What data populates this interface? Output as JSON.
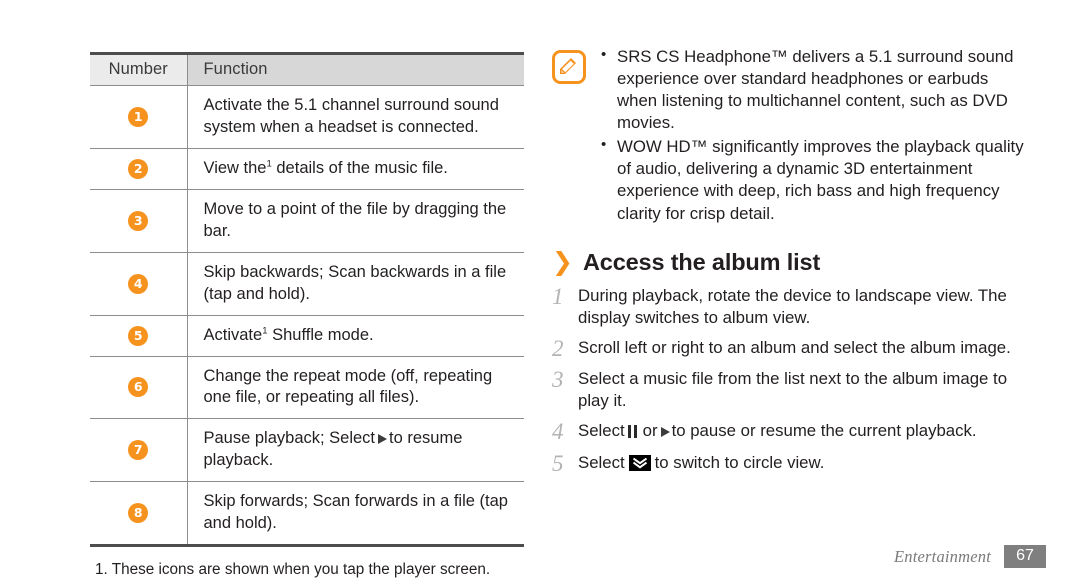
{
  "page": {
    "footer_label": "Entertainment",
    "footer_page_number": "67",
    "accent_color": "#f6921e",
    "text_color": "#231f20",
    "footer_color": "#7f7f7f"
  },
  "table": {
    "headers": {
      "number": "Number",
      "function": "Function"
    },
    "rows": [
      {
        "number": "1",
        "text": "Activate the 5.1 channel surround sound system when a headset is connected.",
        "footnote_marker": ""
      },
      {
        "number": "2",
        "text_before": "View the",
        "footnote_marker": "1",
        "text_after": " details of the music file."
      },
      {
        "number": "3",
        "text": "Move to a point of the file by dragging the bar.",
        "footnote_marker": ""
      },
      {
        "number": "4",
        "text": "Skip backwards; Scan backwards in a file (tap and hold).",
        "footnote_marker": ""
      },
      {
        "number": "5",
        "text_before": "Activate",
        "footnote_marker": "1",
        "text_after": " Shuffle mode."
      },
      {
        "number": "6",
        "text": "Change the repeat mode (off, repeating one file, or repeating all files).",
        "footnote_marker": ""
      },
      {
        "number": "7",
        "text_before": "Pause playback; Select",
        "icon": "play-icon",
        "text_after": "to resume playback."
      },
      {
        "number": "8",
        "text": "Skip forwards; Scan forwards in a file (tap and hold).",
        "footnote_marker": ""
      }
    ],
    "footnote": "1. These icons are shown when you tap the player screen."
  },
  "note": {
    "icon_name": "note-pencil-icon",
    "bullets": [
      "SRS CS Headphone™ delivers a 5.1 surround sound experience over standard headphones or earbuds when listening to multichannel content, such as DVD movies.",
      "WOW HD™ significantly improves the playback quality of audio, delivering a dynamic 3D entertainment experience with deep, rich bass and high frequency clarity for crisp detail."
    ]
  },
  "section": {
    "chevron": "❯",
    "heading": "Access the album list",
    "steps": [
      {
        "num": "1",
        "text": "During playback, rotate the device to landscape view. The display switches to album view."
      },
      {
        "num": "2",
        "text": "Scroll left or right to an album and select the album image."
      },
      {
        "num": "3",
        "text": "Select a music file from the list next to the album image to play it."
      },
      {
        "num": "4",
        "text_before": "Select",
        "icon_1": "pause-icon",
        "text_middle": "or",
        "icon_2": "play-icon",
        "text_after": "to pause or resume the current playback."
      },
      {
        "num": "5",
        "text_before": "Select",
        "icon_1": "circle-view-icon",
        "text_after": "to switch to circle view."
      }
    ]
  }
}
